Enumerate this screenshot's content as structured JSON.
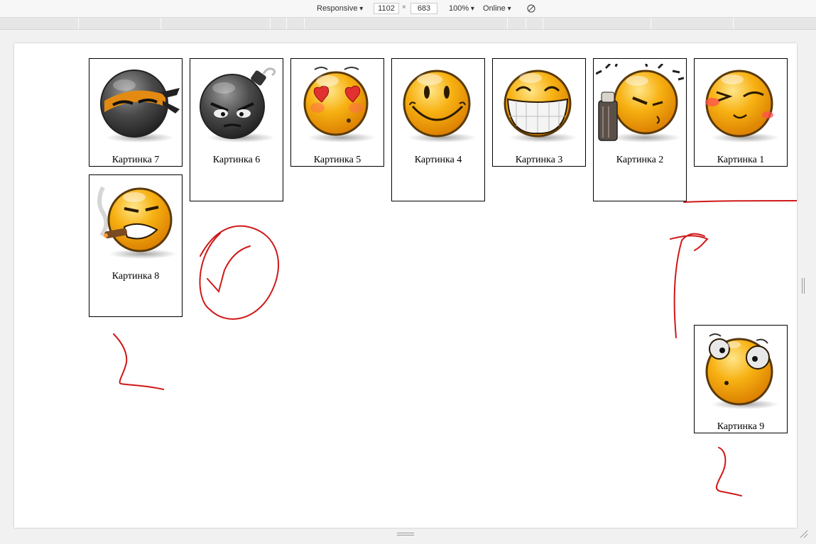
{
  "toolbar": {
    "device_mode": "Responsive",
    "width": "1102",
    "height": "683",
    "zoom": "100%",
    "throttling": "Online",
    "separator": "×"
  },
  "cards": [
    {
      "caption": "Картинка 7",
      "icon": "ninja-smiley-icon"
    },
    {
      "caption": "Картинка 6",
      "icon": "bomb-smiley-icon"
    },
    {
      "caption": "Картинка 5",
      "icon": "heart-eyes-smiley-icon"
    },
    {
      "caption": "Картинка 4",
      "icon": "happy-smiley-icon"
    },
    {
      "caption": "Картинка 3",
      "icon": "grin-smiley-icon"
    },
    {
      "caption": "Картинка 2",
      "icon": "spray-can-smiley-icon"
    },
    {
      "caption": "Картинка 1",
      "icon": "blush-wink-smiley-icon"
    },
    {
      "caption": "Картинка 8",
      "icon": "cigar-smiley-icon"
    },
    {
      "caption": "Картинка 9",
      "icon": "surprised-smiley-icon"
    }
  ],
  "colors": {
    "smiley_orange": "#f5a300",
    "smiley_dark": "#3a3a3a",
    "annotation_red": "#d01818"
  }
}
